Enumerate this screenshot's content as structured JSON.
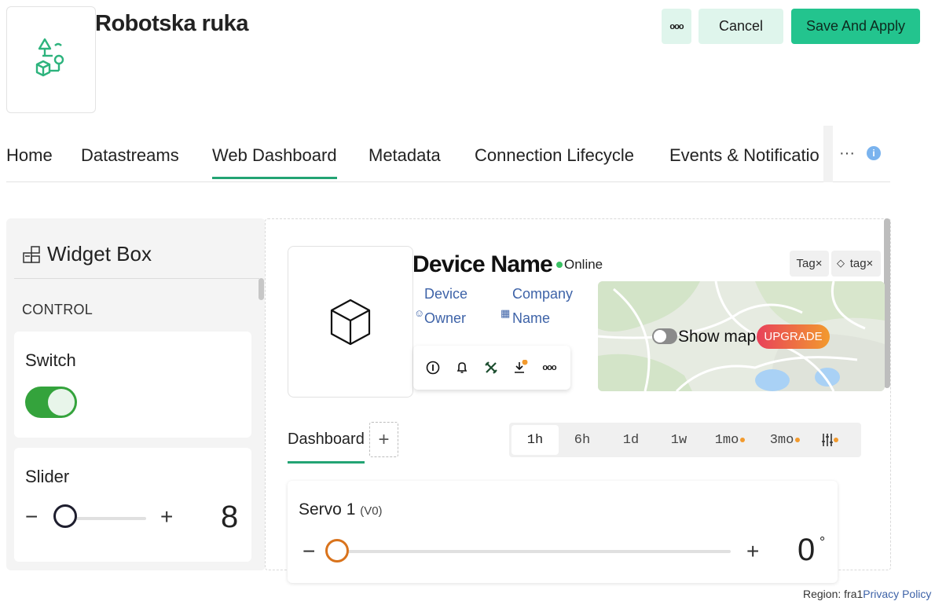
{
  "header": {
    "title": "Robotska ruka",
    "more_label": "ooo",
    "cancel_label": "Cancel",
    "save_label": "Save And Apply",
    "logo_icon": "robot-arm-template-icon",
    "accent": "#23c48e"
  },
  "tabs": {
    "items": [
      {
        "label": "Home"
      },
      {
        "label": "Datastreams"
      },
      {
        "label": "Web Dashboard",
        "active": true
      },
      {
        "label": "Metadata"
      },
      {
        "label": "Connection Lifecycle"
      },
      {
        "label": "Events & Notificatio"
      }
    ],
    "overflow_label": "···",
    "info_label": "i"
  },
  "widget_box": {
    "title": "Widget Box",
    "section": "CONTROL",
    "switch": {
      "label": "Switch",
      "on": true,
      "color": "#34a33c"
    },
    "slider": {
      "label": "Slider",
      "minus": "−",
      "plus": "+",
      "value": "8",
      "level": 0
    }
  },
  "device": {
    "name": "Device Name",
    "status": "Online",
    "status_color": "#3ac163",
    "owner_line1": "Device",
    "owner_line2": "Owner",
    "company_line1": "Company",
    "company_line2": "Name",
    "tags": [
      {
        "label": "Tag×"
      },
      {
        "label": "tag×"
      }
    ],
    "map": {
      "show_map_label": "Show map",
      "upgrade_label": "UPGRADE",
      "enabled": false
    }
  },
  "dashboard": {
    "tab_label": "Dashboard",
    "add_label": "+",
    "ranges": [
      {
        "label": "1h",
        "active": true
      },
      {
        "label": "6h"
      },
      {
        "label": "1d"
      },
      {
        "label": "1w"
      },
      {
        "label": "1mo",
        "locked": true
      },
      {
        "label": "3mo",
        "locked": true
      }
    ],
    "servo": {
      "title": "Servo 1",
      "pin": "(V0)",
      "minus": "−",
      "plus": "+",
      "value": "0",
      "unit": "°",
      "level": 0,
      "color": "#d9731c"
    }
  },
  "footer": {
    "region": "Region: fra1",
    "privacy": "Privacy Policy"
  }
}
